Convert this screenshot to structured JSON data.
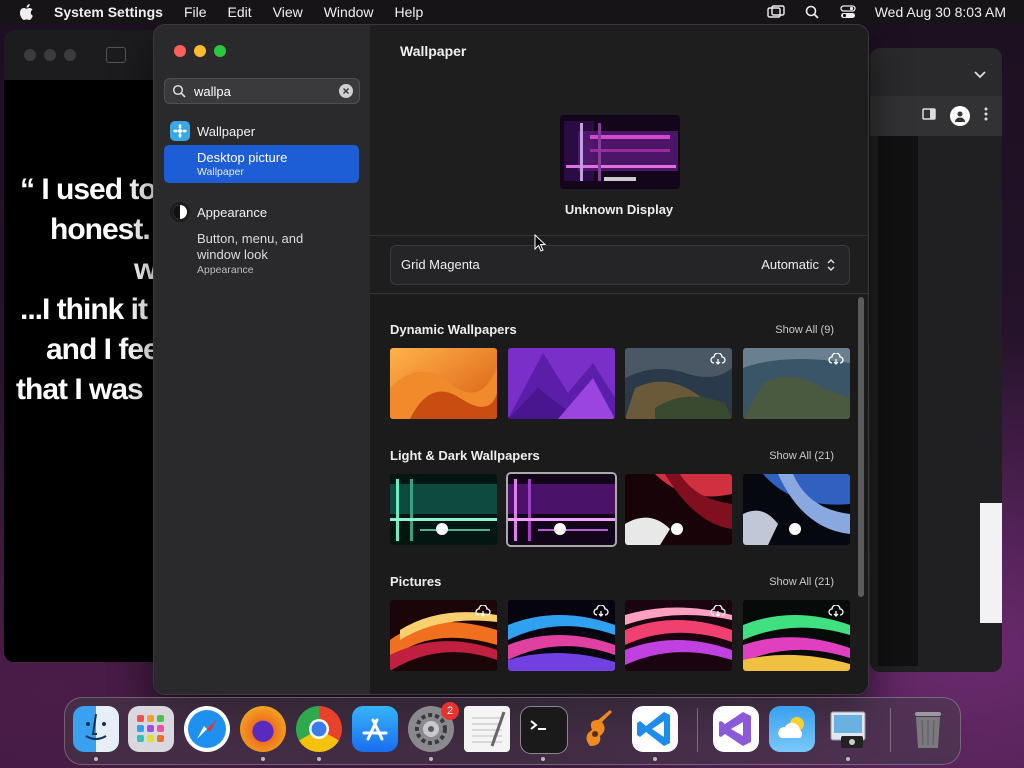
{
  "menubar": {
    "app_name": "System Settings",
    "items": [
      "File",
      "Edit",
      "View",
      "Window",
      "Help"
    ],
    "clock": "Wed Aug 30  8:03 AM"
  },
  "background_video": {
    "quote_lines": [
      "“ I used to",
      "honest.",
      "w",
      "...I think it",
      "and I fee",
      "that I was"
    ]
  },
  "sidebar": {
    "search_value": "wallpa",
    "group1_label": "Wallpaper",
    "selected_title": "Desktop picture",
    "selected_subtitle": "Wallpaper",
    "group2_label": "Appearance",
    "group2_sub_line1": "Button, menu, and",
    "group2_sub_line2": "window look",
    "group2_sub_small": "Appearance"
  },
  "main": {
    "title": "Wallpaper",
    "display_name": "Unknown Display",
    "wallpaper_name": "Grid Magenta",
    "wallpaper_mode": "Automatic",
    "sections": [
      {
        "title": "Dynamic Wallpapers",
        "show_all": "Show All (9)"
      },
      {
        "title": "Light & Dark Wallpapers",
        "show_all": "Show All (21)"
      },
      {
        "title": "Pictures",
        "show_all": "Show All (21)"
      }
    ]
  },
  "dock": {
    "settings_badge": "2",
    "apps": [
      "finder-icon",
      "launchpad-icon",
      "safari-icon",
      "firefox-icon",
      "chrome-icon",
      "app-store-icon",
      "system-settings-icon",
      "textedit-icon",
      "terminal-icon",
      "garageband-icon",
      "vscode-icon",
      "visual-studio-icon",
      "weather-icon",
      "preview-icon",
      "trash-icon"
    ]
  },
  "colors": {
    "accent": "#1d5dd6",
    "close": "#fe5f57",
    "minimize": "#febc2e",
    "zoom": "#28c840"
  }
}
